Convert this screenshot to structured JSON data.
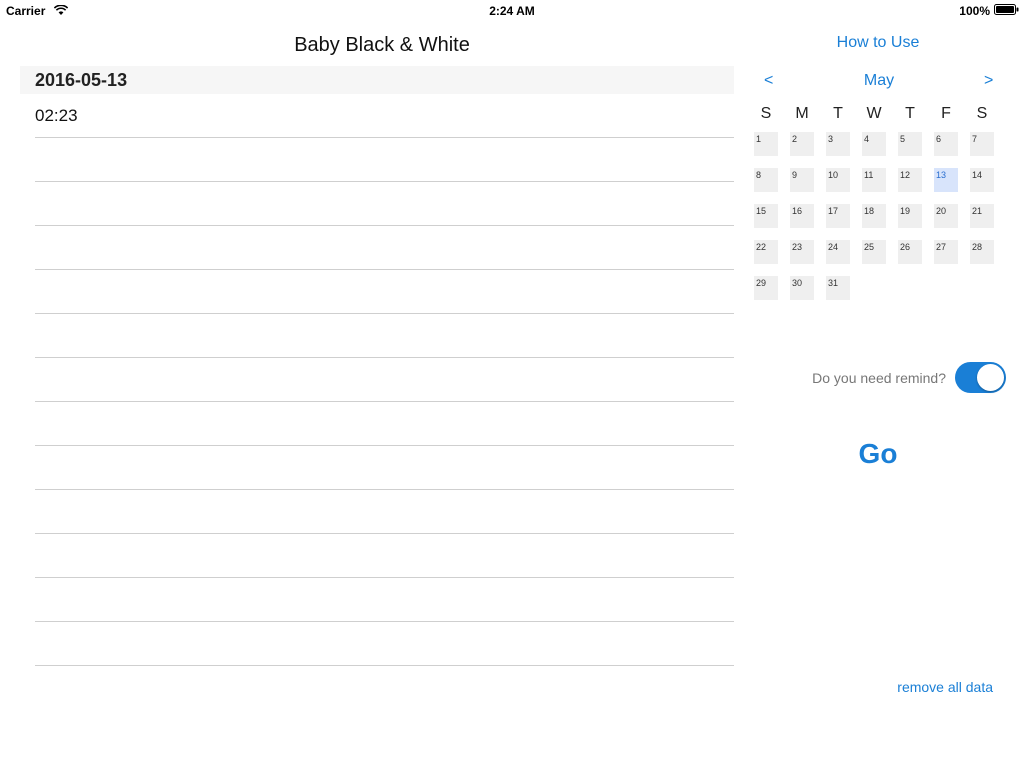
{
  "status_bar": {
    "carrier": "Carrier",
    "time": "2:24 AM",
    "battery": "100%",
    "wifi_icon": "wifi-icon",
    "battery_icon": "battery-icon"
  },
  "main": {
    "title": "Baby Black & White",
    "date": "2016-05-13",
    "entries": [
      "02:23",
      "",
      "",
      "",
      "",
      "",
      "",
      "",
      "",
      "",
      "",
      "",
      ""
    ]
  },
  "sidebar": {
    "how_to_use": "How to Use",
    "calendar": {
      "prev": "<",
      "next": ">",
      "month": "May",
      "weekdays": [
        "S",
        "M",
        "T",
        "W",
        "T",
        "F",
        "S"
      ],
      "days": [
        1,
        2,
        3,
        4,
        5,
        6,
        7,
        8,
        9,
        10,
        11,
        12,
        13,
        14,
        15,
        16,
        17,
        18,
        19,
        20,
        21,
        22,
        23,
        24,
        25,
        26,
        27,
        28,
        29,
        30,
        31
      ],
      "selected_day": 13
    },
    "remind_label": "Do you need remind?",
    "remind_on": true,
    "go_label": "Go",
    "remove_label": "remove all data"
  },
  "colors": {
    "accent": "#1a7fd6",
    "selected_day_bg": "#d8e4fb"
  }
}
